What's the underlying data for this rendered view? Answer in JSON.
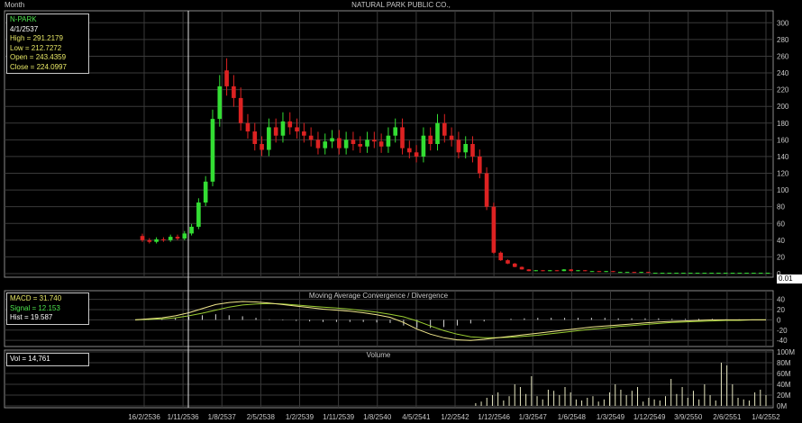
{
  "window": {
    "period": "Month",
    "title": "NATURAL PARK PUBLIC CO.,"
  },
  "info_box": {
    "symbol": "N-PARK",
    "date": "4/1/2537",
    "high": "High  = 291.2179",
    "low": "Low  = 212.7272",
    "open": "Open = 243.4359",
    "close": "Close = 224.0997"
  },
  "macd_box": {
    "macd": "MACD = 31.740",
    "signal": "Signal = 12.153",
    "hist": "Hist = 19.587"
  },
  "vol_box": {
    "vol": "Vol = 14,761"
  },
  "macd_title": "Moving Average Convergence / Divergence",
  "volume_title": "Volume",
  "last_price": "0.01",
  "colors": {
    "up": "#33dd33",
    "down": "#dd2222",
    "grid": "#3a3a3a",
    "text": "#c8c8c8",
    "macd": "#f0e68c",
    "signal": "#9acd32"
  },
  "chart_data": {
    "type": "candlestick",
    "x_labels": [
      "16/2/2536",
      "1/11/2536",
      "1/8/2537",
      "2/5/2538",
      "1/2/2539",
      "1/11/2539",
      "1/8/2540",
      "4/5/2541",
      "1/2/2542",
      "1/12/2546",
      "1/3/2547",
      "1/6/2548",
      "1/3/2549",
      "1/12/2549",
      "3/9/2550",
      "2/6/2551",
      "1/4/2552"
    ],
    "price_axis": {
      "ticks": [
        0,
        20,
        40,
        60,
        80,
        100,
        120,
        140,
        160,
        180,
        200,
        220,
        240,
        260,
        280,
        300
      ],
      "ylim": [
        0,
        310
      ]
    },
    "macd_axis": {
      "ticks": [
        40,
        20,
        0,
        -20,
        -40
      ],
      "ylim": [
        -45,
        50
      ]
    },
    "volume_axis": {
      "ticks": [
        "100M",
        "80M",
        "60M",
        "40M",
        "20M",
        "0M"
      ],
      "ylim": [
        0,
        100
      ]
    },
    "price_series": [
      {
        "o": 45,
        "c": 40
      },
      {
        "o": 40,
        "c": 38
      },
      {
        "o": 38,
        "c": 41
      },
      {
        "o": 41,
        "c": 40
      },
      {
        "o": 40,
        "c": 44
      },
      {
        "o": 44,
        "c": 42
      },
      {
        "o": 42,
        "c": 48
      },
      {
        "o": 48,
        "c": 56
      },
      {
        "o": 56,
        "c": 85
      },
      {
        "o": 85,
        "c": 110
      },
      {
        "o": 110,
        "c": 185
      },
      {
        "o": 185,
        "c": 224
      },
      {
        "o": 243,
        "c": 224
      },
      {
        "o": 224,
        "c": 210
      },
      {
        "o": 210,
        "c": 180
      },
      {
        "o": 180,
        "c": 170
      },
      {
        "o": 170,
        "c": 155
      },
      {
        "o": 155,
        "c": 148
      },
      {
        "o": 148,
        "c": 175
      },
      {
        "o": 175,
        "c": 165
      },
      {
        "o": 165,
        "c": 182
      },
      {
        "o": 182,
        "c": 175
      },
      {
        "o": 175,
        "c": 170
      },
      {
        "o": 170,
        "c": 165
      },
      {
        "o": 165,
        "c": 160
      },
      {
        "o": 160,
        "c": 150
      },
      {
        "o": 150,
        "c": 158
      },
      {
        "o": 158,
        "c": 162
      },
      {
        "o": 162,
        "c": 150
      },
      {
        "o": 150,
        "c": 160
      },
      {
        "o": 160,
        "c": 155
      },
      {
        "o": 155,
        "c": 152
      },
      {
        "o": 152,
        "c": 160
      },
      {
        "o": 160,
        "c": 158
      },
      {
        "o": 158,
        "c": 152
      },
      {
        "o": 152,
        "c": 165
      },
      {
        "o": 165,
        "c": 175
      },
      {
        "o": 175,
        "c": 150
      },
      {
        "o": 150,
        "c": 145
      },
      {
        "o": 145,
        "c": 140
      },
      {
        "o": 140,
        "c": 165
      },
      {
        "o": 165,
        "c": 155
      },
      {
        "o": 155,
        "c": 180
      },
      {
        "o": 180,
        "c": 165
      },
      {
        "o": 165,
        "c": 160
      },
      {
        "o": 160,
        "c": 145
      },
      {
        "o": 145,
        "c": 155
      },
      {
        "o": 155,
        "c": 140
      },
      {
        "o": 140,
        "c": 120
      },
      {
        "o": 120,
        "c": 80
      },
      {
        "o": 80,
        "c": 25
      },
      {
        "o": 25,
        "c": 16
      },
      {
        "o": 16,
        "c": 12
      },
      {
        "o": 12,
        "c": 8
      },
      {
        "o": 8,
        "c": 5
      },
      {
        "o": 5,
        "c": 3
      },
      {
        "o": 3,
        "c": 4
      },
      {
        "o": 4,
        "c": 3
      },
      {
        "o": 3,
        "c": 4
      },
      {
        "o": 4,
        "c": 3
      },
      {
        "o": 3,
        "c": 5
      },
      {
        "o": 5,
        "c": 3
      },
      {
        "o": 3,
        "c": 4
      },
      {
        "o": 4,
        "c": 3
      },
      {
        "o": 3,
        "c": 3
      },
      {
        "o": 3,
        "c": 2
      },
      {
        "o": 2,
        "c": 3
      },
      {
        "o": 3,
        "c": 2
      },
      {
        "o": 2,
        "c": 2
      },
      {
        "o": 2,
        "c": 2
      },
      {
        "o": 2,
        "c": 1
      },
      {
        "o": 1,
        "c": 2
      },
      {
        "o": 2,
        "c": 1
      },
      {
        "o": 1,
        "c": 1
      },
      {
        "o": 1,
        "c": 1
      },
      {
        "o": 1,
        "c": 1
      },
      {
        "o": 1,
        "c": 1
      },
      {
        "o": 1,
        "c": 1
      },
      {
        "o": 1,
        "c": 1
      },
      {
        "o": 1,
        "c": 1
      },
      {
        "o": 1,
        "c": 1
      },
      {
        "o": 1,
        "c": 1
      },
      {
        "o": 1,
        "c": 1
      },
      {
        "o": 1,
        "c": 1
      },
      {
        "o": 1,
        "c": 1
      },
      {
        "o": 1,
        "c": 1
      },
      {
        "o": 1,
        "c": 1
      },
      {
        "o": 1,
        "c": 1
      },
      {
        "o": 1,
        "c": 1
      },
      {
        "o": 1,
        "c": 1
      }
    ],
    "volume_series": [
      0,
      0,
      0,
      0,
      0,
      0,
      0,
      0,
      0,
      0,
      0,
      0,
      0,
      0,
      0,
      0,
      0,
      0,
      0,
      0,
      0,
      0,
      0,
      0,
      0,
      0,
      0,
      0,
      0,
      0,
      0,
      0,
      0,
      0,
      0,
      0,
      0,
      0,
      0,
      0,
      0,
      0,
      0,
      0,
      0,
      0,
      0,
      0,
      0,
      0,
      0,
      0,
      0,
      0,
      0,
      0,
      0,
      0,
      0,
      0,
      0,
      5,
      8,
      15,
      20,
      25,
      10,
      18,
      40,
      35,
      22,
      55,
      18,
      12,
      30,
      28,
      20,
      35,
      25,
      12,
      10,
      15,
      18,
      8,
      12,
      25,
      40,
      30,
      20,
      28,
      35,
      8,
      15,
      12,
      10,
      18,
      50,
      22,
      35,
      15,
      28,
      12,
      40,
      20,
      10,
      80,
      75,
      40,
      15,
      12,
      10,
      25,
      30,
      20
    ],
    "macd_series": [
      0,
      2,
      4,
      8,
      14,
      22,
      30,
      34,
      36,
      35,
      33,
      30,
      27,
      24,
      21,
      19,
      17,
      14,
      10,
      5,
      -5,
      -18,
      -28,
      -35,
      -39,
      -40,
      -38,
      -35,
      -32,
      -29,
      -26,
      -23,
      -20,
      -17,
      -14,
      -12,
      -10,
      -8,
      -6,
      -4,
      -3,
      -2,
      -1,
      0,
      0,
      0,
      0,
      0
    ],
    "signal_series": [
      0,
      1,
      2,
      4,
      8,
      13,
      19,
      25,
      29,
      31,
      32,
      31,
      29,
      27,
      25,
      23,
      21,
      18,
      15,
      11,
      6,
      -2,
      -12,
      -21,
      -28,
      -33,
      -35,
      -35,
      -34,
      -32,
      -30,
      -27,
      -24,
      -21,
      -18,
      -16,
      -13,
      -11,
      -9,
      -7,
      -5,
      -4,
      -3,
      -2,
      -1,
      -1,
      0,
      0
    ]
  }
}
